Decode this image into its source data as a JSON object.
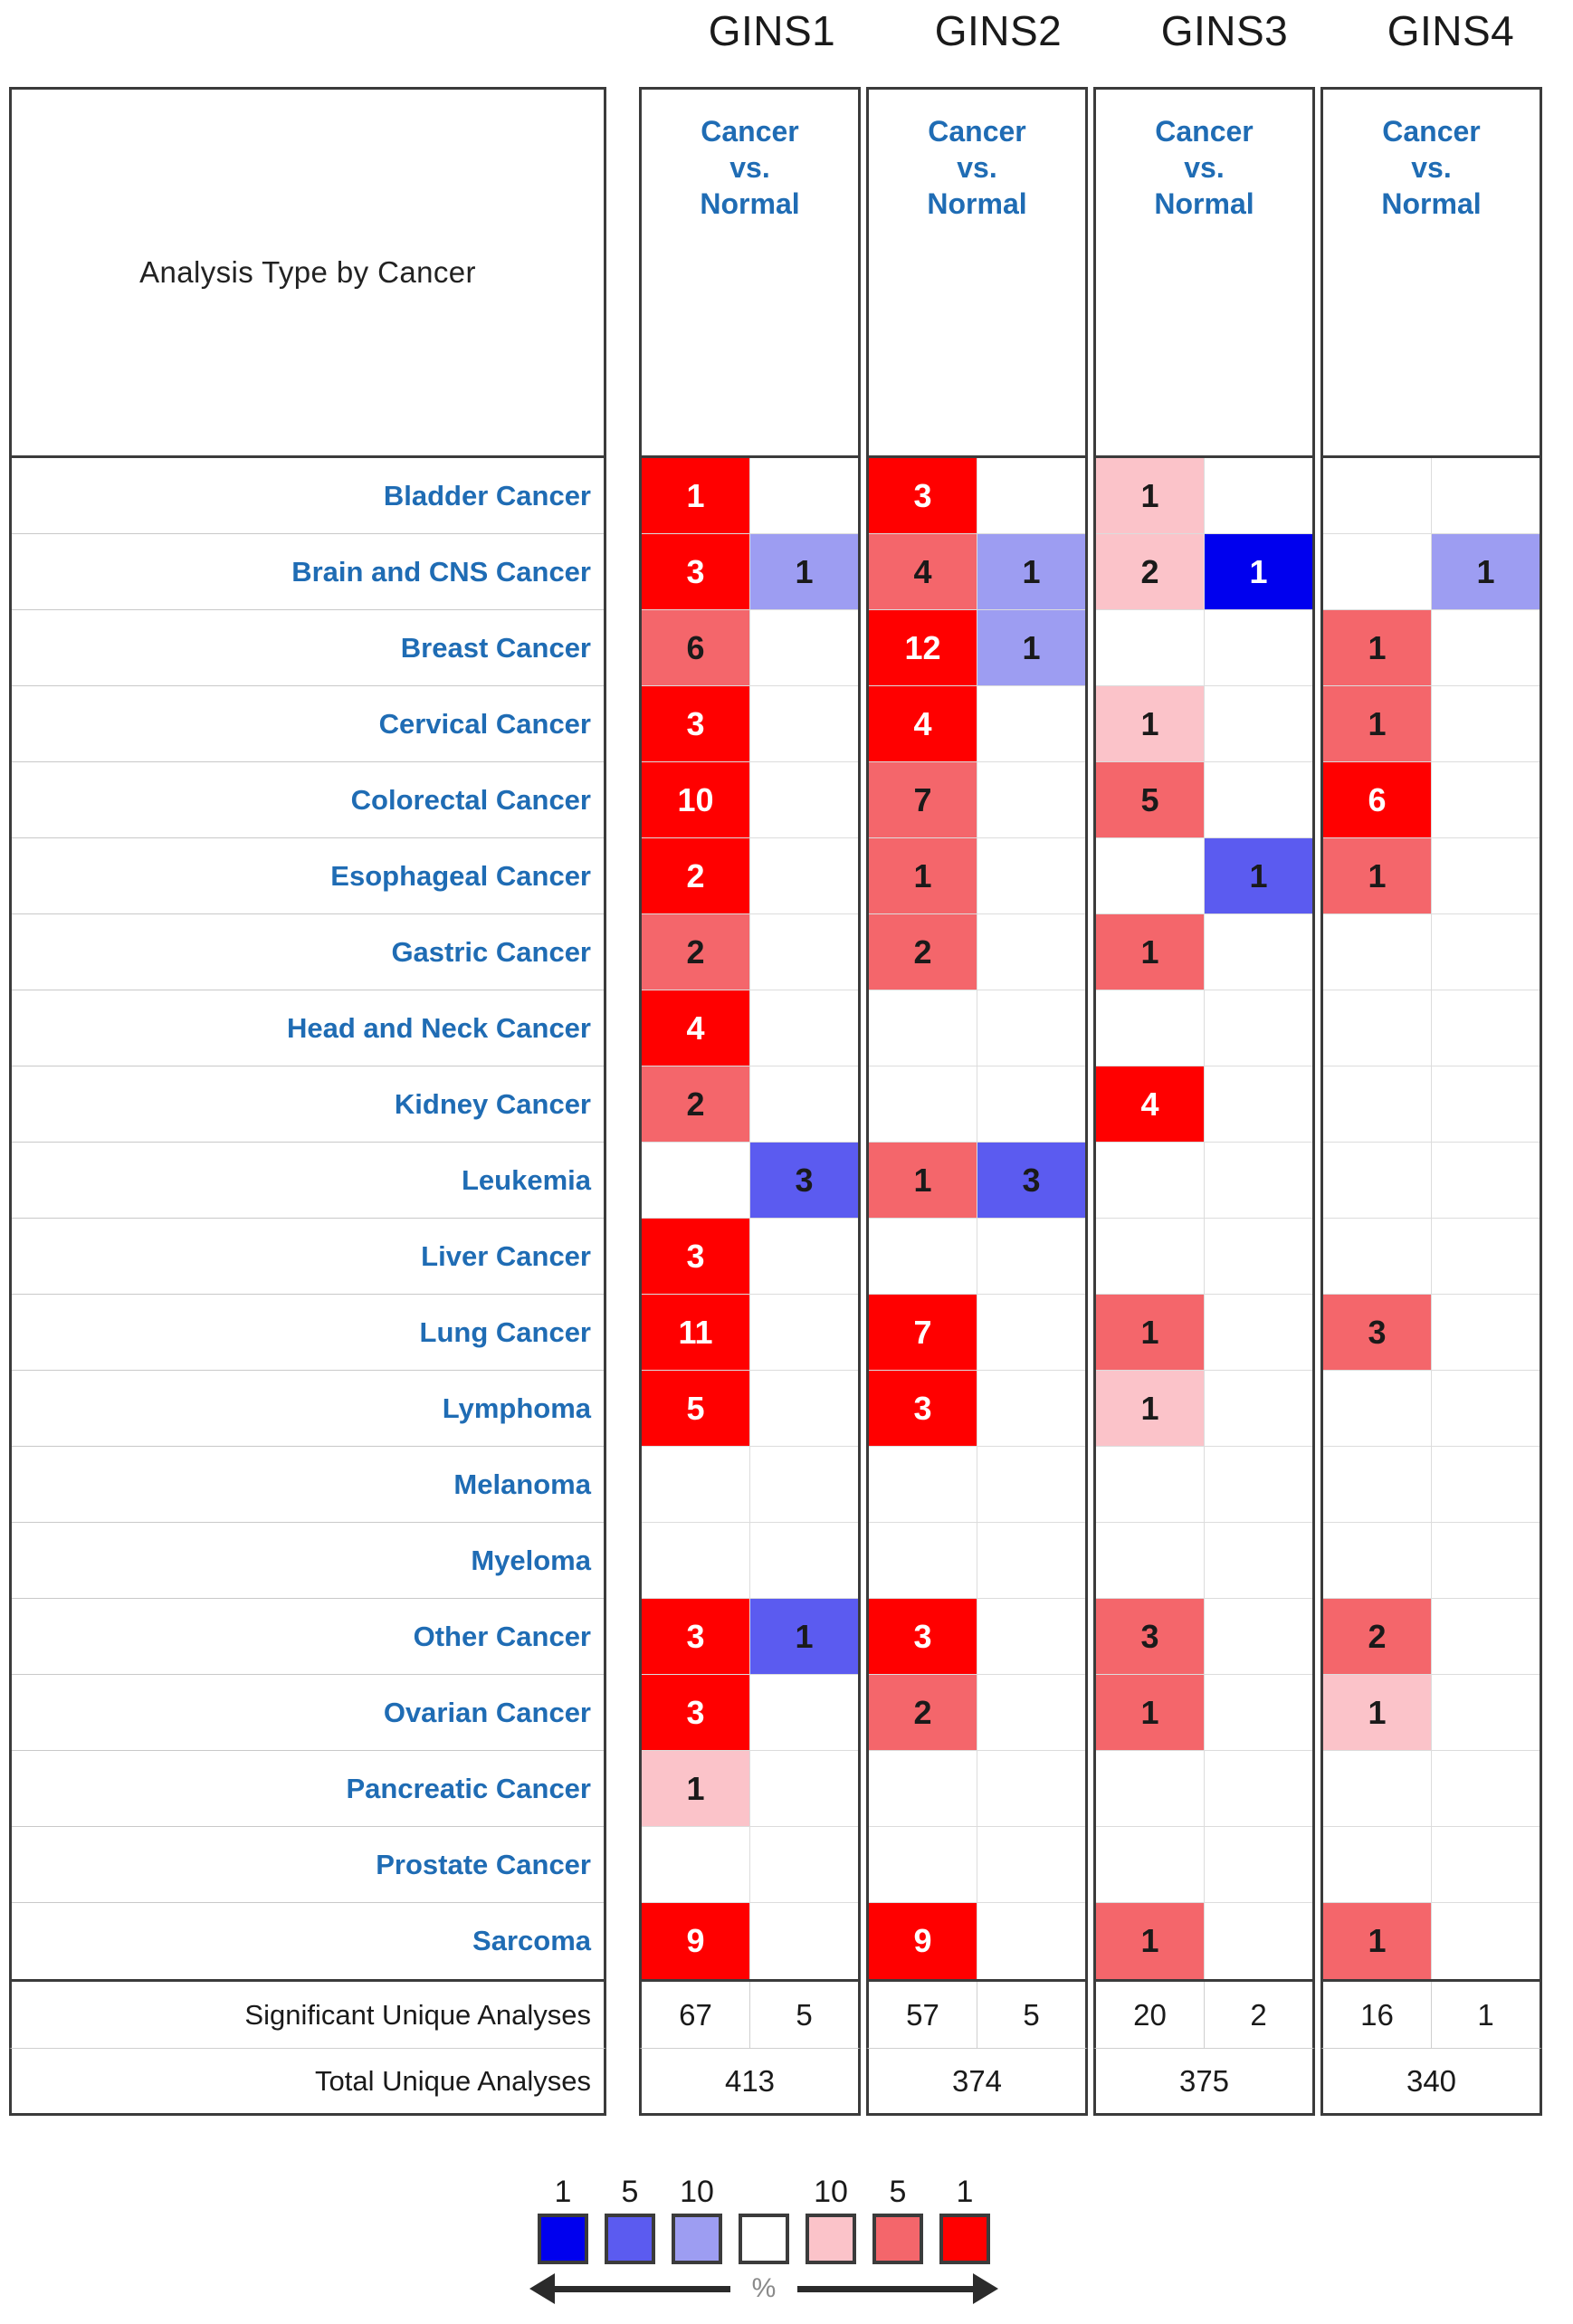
{
  "title_cell": "Analysis Type by Cancer",
  "genes": [
    "GINS1",
    "GINS2",
    "GINS3",
    "GINS4"
  ],
  "column_header": {
    "line1": "Cancer",
    "line2": "vs.",
    "line3": "Normal"
  },
  "footer_labels": {
    "significant": "Significant Unique Analyses",
    "total": "Total Unique Analyses"
  },
  "legend": {
    "under_labels": [
      "1",
      "5",
      "10"
    ],
    "over_labels": [
      "10",
      "5",
      "1"
    ],
    "percent_symbol": "%",
    "swatch_colors": [
      "#0000ee",
      "#5b5bf0",
      "#9d9df2",
      "#ffffff",
      "#fbc3c9",
      "#f4666b",
      "#ff0000"
    ]
  },
  "chart_data": {
    "type": "heatmap",
    "title": "Analysis Type by Cancer",
    "xlabel": "",
    "ylabel": "",
    "genes": [
      "GINS1",
      "GINS2",
      "GINS3",
      "GINS4"
    ],
    "subcolumns": [
      "over-expression",
      "under-expression"
    ],
    "legend_scale": {
      "over_expression_percentiles": [
        10,
        5,
        1
      ],
      "under_expression_percentiles": [
        10,
        5,
        1
      ],
      "colors": {
        "over_1": "#ff0000",
        "over_5": "#f4666b",
        "over_10": "#fbc3c9",
        "under_1": "#0000ee",
        "under_5": "#5b5bf0",
        "under_10": "#9d9df2",
        "none": "#ffffff"
      }
    },
    "categories": [
      "Bladder Cancer",
      "Brain and CNS Cancer",
      "Breast Cancer",
      "Cervical Cancer",
      "Colorectal Cancer",
      "Esophageal Cancer",
      "Gastric Cancer",
      "Head and Neck Cancer",
      "Kidney Cancer",
      "Leukemia",
      "Liver Cancer",
      "Lung Cancer",
      "Lymphoma",
      "Melanoma",
      "Myeloma",
      "Other Cancer",
      "Ovarian Cancer",
      "Pancreatic Cancer",
      "Prostate Cancer",
      "Sarcoma"
    ],
    "rows": [
      {
        "label": "Bladder Cancer",
        "cells": [
          {
            "v": "1",
            "t": "r1"
          },
          {
            "v": "",
            "t": ""
          },
          {
            "v": "3",
            "t": "r1"
          },
          {
            "v": "",
            "t": ""
          },
          {
            "v": "1",
            "t": "r10"
          },
          {
            "v": "",
            "t": ""
          },
          {
            "v": "",
            "t": ""
          },
          {
            "v": "",
            "t": ""
          }
        ]
      },
      {
        "label": "Brain and CNS Cancer",
        "cells": [
          {
            "v": "3",
            "t": "r1"
          },
          {
            "v": "1",
            "t": "b10"
          },
          {
            "v": "4",
            "t": "r5"
          },
          {
            "v": "1",
            "t": "b10"
          },
          {
            "v": "2",
            "t": "r10"
          },
          {
            "v": "1",
            "t": "b1"
          },
          {
            "v": "",
            "t": ""
          },
          {
            "v": "1",
            "t": "b10"
          }
        ]
      },
      {
        "label": "Breast Cancer",
        "cells": [
          {
            "v": "6",
            "t": "r5"
          },
          {
            "v": "",
            "t": ""
          },
          {
            "v": "12",
            "t": "r1"
          },
          {
            "v": "1",
            "t": "b10"
          },
          {
            "v": "",
            "t": ""
          },
          {
            "v": "",
            "t": ""
          },
          {
            "v": "1",
            "t": "r5"
          },
          {
            "v": "",
            "t": ""
          }
        ]
      },
      {
        "label": "Cervical Cancer",
        "cells": [
          {
            "v": "3",
            "t": "r1"
          },
          {
            "v": "",
            "t": ""
          },
          {
            "v": "4",
            "t": "r1"
          },
          {
            "v": "",
            "t": ""
          },
          {
            "v": "1",
            "t": "r10"
          },
          {
            "v": "",
            "t": ""
          },
          {
            "v": "1",
            "t": "r5"
          },
          {
            "v": "",
            "t": ""
          }
        ]
      },
      {
        "label": "Colorectal Cancer",
        "cells": [
          {
            "v": "10",
            "t": "r1"
          },
          {
            "v": "",
            "t": ""
          },
          {
            "v": "7",
            "t": "r5"
          },
          {
            "v": "",
            "t": ""
          },
          {
            "v": "5",
            "t": "r5"
          },
          {
            "v": "",
            "t": ""
          },
          {
            "v": "6",
            "t": "r1"
          },
          {
            "v": "",
            "t": ""
          }
        ]
      },
      {
        "label": "Esophageal Cancer",
        "cells": [
          {
            "v": "2",
            "t": "r1"
          },
          {
            "v": "",
            "t": ""
          },
          {
            "v": "1",
            "t": "r5"
          },
          {
            "v": "",
            "t": ""
          },
          {
            "v": "",
            "t": ""
          },
          {
            "v": "1",
            "t": "b5"
          },
          {
            "v": "1",
            "t": "r5"
          },
          {
            "v": "",
            "t": ""
          }
        ]
      },
      {
        "label": "Gastric Cancer",
        "cells": [
          {
            "v": "2",
            "t": "r5"
          },
          {
            "v": "",
            "t": ""
          },
          {
            "v": "2",
            "t": "r5"
          },
          {
            "v": "",
            "t": ""
          },
          {
            "v": "1",
            "t": "r5"
          },
          {
            "v": "",
            "t": ""
          },
          {
            "v": "",
            "t": ""
          },
          {
            "v": "",
            "t": ""
          }
        ]
      },
      {
        "label": "Head and Neck Cancer",
        "cells": [
          {
            "v": "4",
            "t": "r1"
          },
          {
            "v": "",
            "t": ""
          },
          {
            "v": "",
            "t": ""
          },
          {
            "v": "",
            "t": ""
          },
          {
            "v": "",
            "t": ""
          },
          {
            "v": "",
            "t": ""
          },
          {
            "v": "",
            "t": ""
          },
          {
            "v": "",
            "t": ""
          }
        ]
      },
      {
        "label": "Kidney Cancer",
        "cells": [
          {
            "v": "2",
            "t": "r5"
          },
          {
            "v": "",
            "t": ""
          },
          {
            "v": "",
            "t": ""
          },
          {
            "v": "",
            "t": ""
          },
          {
            "v": "4",
            "t": "r1"
          },
          {
            "v": "",
            "t": ""
          },
          {
            "v": "",
            "t": ""
          },
          {
            "v": "",
            "t": ""
          }
        ]
      },
      {
        "label": "Leukemia",
        "cells": [
          {
            "v": "",
            "t": ""
          },
          {
            "v": "3",
            "t": "b5"
          },
          {
            "v": "1",
            "t": "r5"
          },
          {
            "v": "3",
            "t": "b5"
          },
          {
            "v": "",
            "t": ""
          },
          {
            "v": "",
            "t": ""
          },
          {
            "v": "",
            "t": ""
          },
          {
            "v": "",
            "t": ""
          }
        ]
      },
      {
        "label": "Liver Cancer",
        "cells": [
          {
            "v": "3",
            "t": "r1"
          },
          {
            "v": "",
            "t": ""
          },
          {
            "v": "",
            "t": ""
          },
          {
            "v": "",
            "t": ""
          },
          {
            "v": "",
            "t": ""
          },
          {
            "v": "",
            "t": ""
          },
          {
            "v": "",
            "t": ""
          },
          {
            "v": "",
            "t": ""
          }
        ]
      },
      {
        "label": "Lung Cancer",
        "cells": [
          {
            "v": "11",
            "t": "r1"
          },
          {
            "v": "",
            "t": ""
          },
          {
            "v": "7",
            "t": "r1"
          },
          {
            "v": "",
            "t": ""
          },
          {
            "v": "1",
            "t": "r5"
          },
          {
            "v": "",
            "t": ""
          },
          {
            "v": "3",
            "t": "r5"
          },
          {
            "v": "",
            "t": ""
          }
        ]
      },
      {
        "label": "Lymphoma",
        "cells": [
          {
            "v": "5",
            "t": "r1"
          },
          {
            "v": "",
            "t": ""
          },
          {
            "v": "3",
            "t": "r1"
          },
          {
            "v": "",
            "t": ""
          },
          {
            "v": "1",
            "t": "r10"
          },
          {
            "v": "",
            "t": ""
          },
          {
            "v": "",
            "t": ""
          },
          {
            "v": "",
            "t": ""
          }
        ]
      },
      {
        "label": "Melanoma",
        "cells": [
          {
            "v": "",
            "t": ""
          },
          {
            "v": "",
            "t": ""
          },
          {
            "v": "",
            "t": ""
          },
          {
            "v": "",
            "t": ""
          },
          {
            "v": "",
            "t": ""
          },
          {
            "v": "",
            "t": ""
          },
          {
            "v": "",
            "t": ""
          },
          {
            "v": "",
            "t": ""
          }
        ]
      },
      {
        "label": "Myeloma",
        "cells": [
          {
            "v": "",
            "t": ""
          },
          {
            "v": "",
            "t": ""
          },
          {
            "v": "",
            "t": ""
          },
          {
            "v": "",
            "t": ""
          },
          {
            "v": "",
            "t": ""
          },
          {
            "v": "",
            "t": ""
          },
          {
            "v": "",
            "t": ""
          },
          {
            "v": "",
            "t": ""
          }
        ]
      },
      {
        "label": "Other Cancer",
        "cells": [
          {
            "v": "3",
            "t": "r1"
          },
          {
            "v": "1",
            "t": "b5"
          },
          {
            "v": "3",
            "t": "r1"
          },
          {
            "v": "",
            "t": ""
          },
          {
            "v": "3",
            "t": "r5"
          },
          {
            "v": "",
            "t": ""
          },
          {
            "v": "2",
            "t": "r5"
          },
          {
            "v": "",
            "t": ""
          }
        ]
      },
      {
        "label": "Ovarian Cancer",
        "cells": [
          {
            "v": "3",
            "t": "r1"
          },
          {
            "v": "",
            "t": ""
          },
          {
            "v": "2",
            "t": "r5"
          },
          {
            "v": "",
            "t": ""
          },
          {
            "v": "1",
            "t": "r5"
          },
          {
            "v": "",
            "t": ""
          },
          {
            "v": "1",
            "t": "r10"
          },
          {
            "v": "",
            "t": ""
          }
        ]
      },
      {
        "label": "Pancreatic Cancer",
        "cells": [
          {
            "v": "1",
            "t": "r10"
          },
          {
            "v": "",
            "t": ""
          },
          {
            "v": "",
            "t": ""
          },
          {
            "v": "",
            "t": ""
          },
          {
            "v": "",
            "t": ""
          },
          {
            "v": "",
            "t": ""
          },
          {
            "v": "",
            "t": ""
          },
          {
            "v": "",
            "t": ""
          }
        ]
      },
      {
        "label": "Prostate Cancer",
        "cells": [
          {
            "v": "",
            "t": ""
          },
          {
            "v": "",
            "t": ""
          },
          {
            "v": "",
            "t": ""
          },
          {
            "v": "",
            "t": ""
          },
          {
            "v": "",
            "t": ""
          },
          {
            "v": "",
            "t": ""
          },
          {
            "v": "",
            "t": ""
          },
          {
            "v": "",
            "t": ""
          }
        ]
      },
      {
        "label": "Sarcoma",
        "cells": [
          {
            "v": "9",
            "t": "r1"
          },
          {
            "v": "",
            "t": ""
          },
          {
            "v": "9",
            "t": "r1"
          },
          {
            "v": "",
            "t": ""
          },
          {
            "v": "1",
            "t": "r5"
          },
          {
            "v": "",
            "t": ""
          },
          {
            "v": "1",
            "t": "r5"
          },
          {
            "v": "",
            "t": ""
          }
        ]
      }
    ],
    "significant_unique_analyses": [
      {
        "gene": "GINS1",
        "over": "67",
        "under": "5"
      },
      {
        "gene": "GINS2",
        "over": "57",
        "under": "5"
      },
      {
        "gene": "GINS3",
        "over": "20",
        "under": "2"
      },
      {
        "gene": "GINS4",
        "over": "16",
        "under": "1"
      }
    ],
    "total_unique_analyses": [
      {
        "gene": "GINS1",
        "total": "413"
      },
      {
        "gene": "GINS2",
        "total": "374"
      },
      {
        "gene": "GINS3",
        "total": "375"
      },
      {
        "gene": "GINS4",
        "total": "340"
      }
    ]
  }
}
